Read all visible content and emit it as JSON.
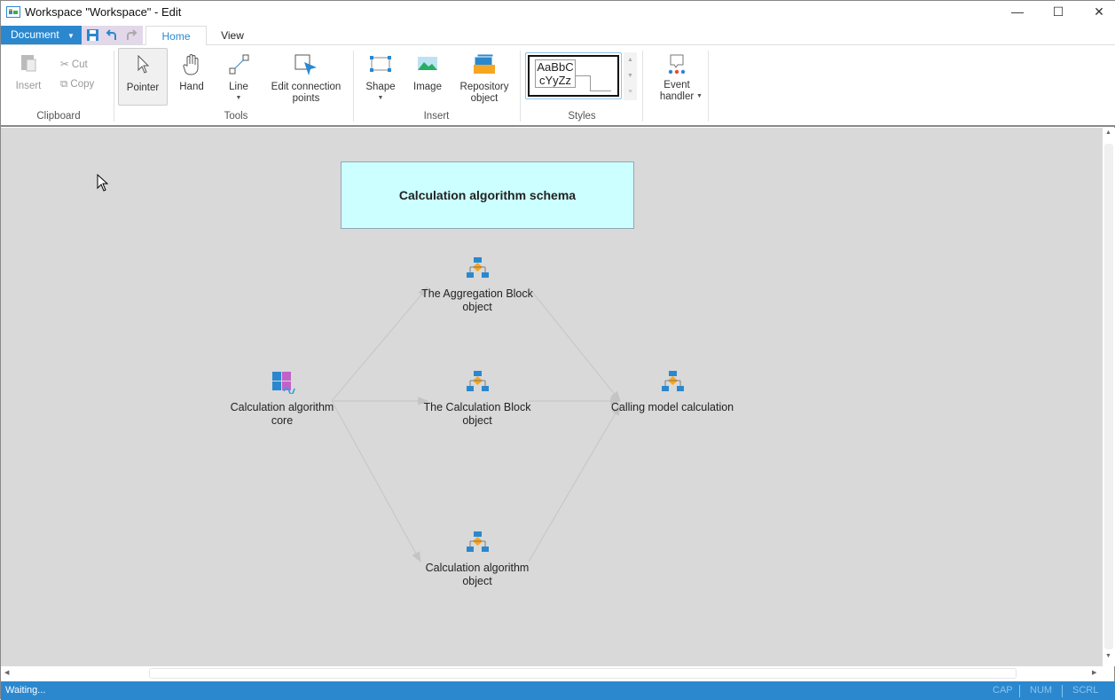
{
  "window": {
    "title": "Workspace \"Workspace\" - Edit",
    "controls": {
      "minimize": "—",
      "maximize": "☐",
      "close": "✕"
    }
  },
  "menu": {
    "document_label": "Document",
    "tabs": [
      {
        "label": "Home",
        "active": true
      },
      {
        "label": "View",
        "active": false
      }
    ]
  },
  "ribbon": {
    "clipboard": {
      "group": "Clipboard",
      "insert": "Insert",
      "cut": "Cut",
      "copy": "Copy"
    },
    "tools": {
      "group": "Tools",
      "pointer": "Pointer",
      "hand": "Hand",
      "line": "Line",
      "edit_points": "Edit connection points"
    },
    "insert": {
      "group": "Insert",
      "shape": "Shape",
      "image": "Image",
      "repository": "Repository object"
    },
    "styles": {
      "group": "Styles",
      "sample_line1": "AaBbC",
      "sample_line2": "cYyZz"
    },
    "event": {
      "label": "Event handler"
    }
  },
  "diagram": {
    "title": "Calculation algorithm schema",
    "nodes": {
      "core": "Calculation algorithm core",
      "aggregation": "The Aggregation Block object",
      "calc_block": "The Calculation Block object",
      "algo_object": "Calculation algorithm object",
      "calling": "Calling model calculation"
    },
    "colors": {
      "title_fill": "#ccffff",
      "canvas": "#d9d9d9",
      "accent": "#2b88cf"
    }
  },
  "status": {
    "text": "Waiting...",
    "cap": "CAP",
    "num": "NUM",
    "scrl": "SCRL"
  }
}
